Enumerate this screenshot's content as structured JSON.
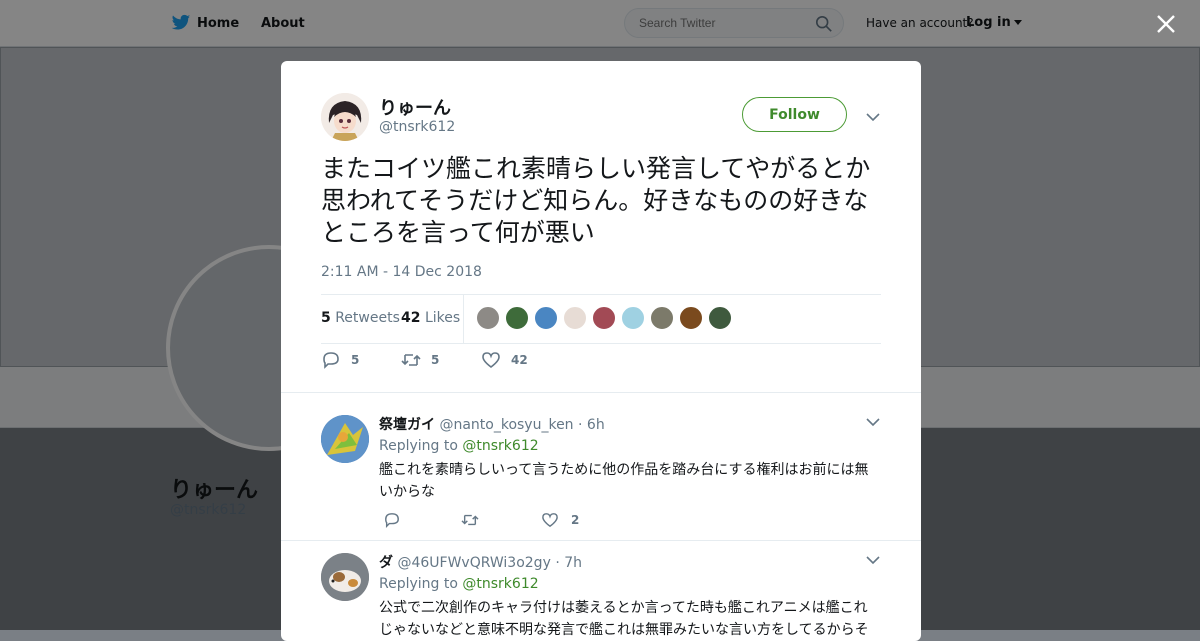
{
  "topbar": {
    "home_label": "Home",
    "about_label": "About",
    "search_placeholder": "Search Twitter",
    "have_account": "Have an account?",
    "login_label": "Log in"
  },
  "background_profile": {
    "name": "りゅーん",
    "handle": "@tnsrk612"
  },
  "tweet": {
    "author_name": "りゅーん",
    "author_handle": "@tnsrk612",
    "follow_label": "Follow",
    "text": "またコイツ艦これ素晴らしい発言してやがるとか思われてそうだけど知らん。好きなものの好きなところを言って何が悪い",
    "timestamp": "2:11 AM - 14 Dec 2018",
    "retweets_count": "5",
    "retweets_label": "Retweets",
    "likes_count": "42",
    "likes_label": "Likes",
    "reply_count": "5",
    "retweet_count": "5",
    "like_count": "42",
    "likers_colors": [
      "#8d8a86",
      "#3e6b3a",
      "#4a86c2",
      "#e7dcd5",
      "#a24a55",
      "#9fd1e2",
      "#7c7a6a",
      "#7a4a1e",
      "#3f5a3e"
    ]
  },
  "replies": [
    {
      "name": "祭壇ガイ",
      "handle": "@nanto_kosyu_ken",
      "time": "· 6h",
      "replying_prefix": "Replying to",
      "replying_to": "@tnsrk612",
      "text": "艦これを素晴らしいって言うために他の作品を踏み台にする権利はお前には無いからな",
      "reply_count": "",
      "retweet_count": "",
      "like_count": "2"
    },
    {
      "name": "ダ",
      "handle": "@46UFWvQRWi3o2gy",
      "time": "· 7h",
      "replying_prefix": "Replying to",
      "replying_to": "@tnsrk612",
      "text": "公式で二次創作のキャラ付けは萎えるとか言ってた時も艦これアニメは艦これじゃないなどと意味不明な発言で艦これは無罪みたいな言い方をしてるからそ"
    }
  ],
  "colors": {
    "accent_green": "#3f8a2c",
    "text_dark": "#14171a",
    "text_muted": "#657786"
  }
}
